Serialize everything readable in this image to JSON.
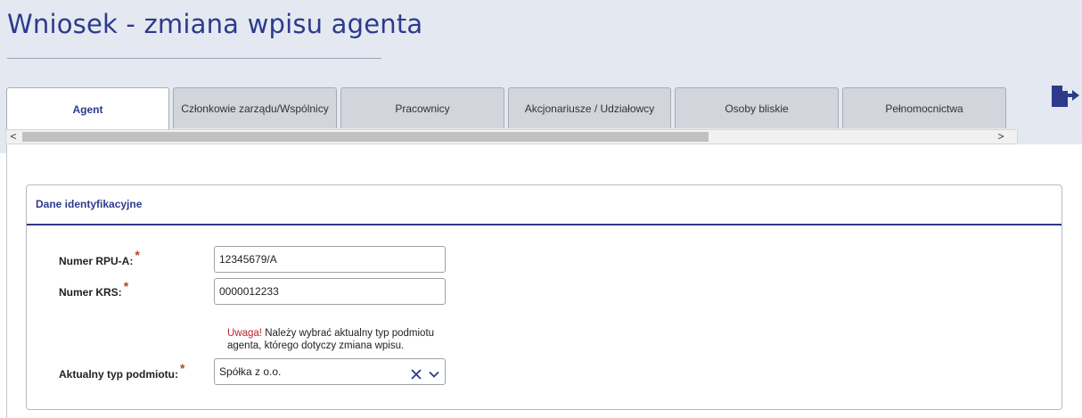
{
  "page": {
    "title": "Wniosek - zmiana wpisu agenta"
  },
  "tabs": [
    {
      "label": "Agent",
      "active": true
    },
    {
      "label": "Członkowie zarządu/Wspólnicy",
      "active": false
    },
    {
      "label": "Pracownicy",
      "active": false
    },
    {
      "label": "Akcjonariusze / Udziałowcy",
      "active": false
    },
    {
      "label": "Osoby bliskie",
      "active": false
    },
    {
      "label": "Pełnomocnictwa",
      "active": false
    }
  ],
  "scrollbar": {
    "left_arrow": "<",
    "right_arrow": ">"
  },
  "icons": {
    "logout": "logout-icon",
    "clear": "clear-icon",
    "dropdown": "chevron-down-icon"
  },
  "panel": {
    "title": "Dane identyfikacyjne",
    "fields": {
      "rpu": {
        "label": "Numer RPU-A:",
        "required_mark": "*",
        "value": "12345679/A"
      },
      "krs": {
        "label": "Numer KRS:",
        "required_mark": "*",
        "value": "0000012233"
      },
      "entity_type": {
        "label": "Aktualny typ podmiotu:",
        "required_mark": "*",
        "value": "Spółka z o.o."
      }
    },
    "warning": {
      "prefix": "Uwaga!",
      "text": " Należy wybrać aktualny typ podmiotu agenta, którego dotyczy zmiana wpisu."
    }
  },
  "colors": {
    "accent": "#2d3a8c",
    "header_bg": "#e4e9f1",
    "warning": "#b5262a",
    "required": "#b5442a"
  }
}
